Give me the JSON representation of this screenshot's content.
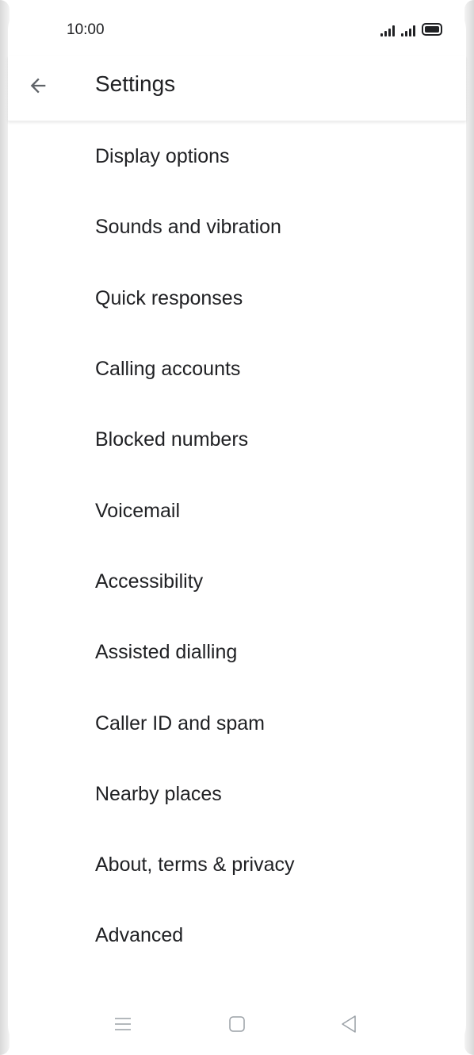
{
  "status_bar": {
    "time": "10:00"
  },
  "header": {
    "back_label": "Back",
    "title": "Settings"
  },
  "menu": {
    "items": [
      {
        "label": "Display options"
      },
      {
        "label": "Sounds and vibration"
      },
      {
        "label": "Quick responses"
      },
      {
        "label": "Calling accounts"
      },
      {
        "label": "Blocked numbers"
      },
      {
        "label": "Voicemail"
      },
      {
        "label": "Accessibility"
      },
      {
        "label": "Assisted dialling"
      },
      {
        "label": "Caller ID and spam"
      },
      {
        "label": "Nearby places"
      },
      {
        "label": "About, terms & privacy"
      },
      {
        "label": "Advanced"
      }
    ]
  },
  "nav_bar": {
    "icons": [
      "menu-icon",
      "home-icon",
      "back-triangle-icon"
    ]
  },
  "colors": {
    "text": "#202124",
    "icon": "#5f6368",
    "nav_icon": "#9aa0a6",
    "background": "#ffffff"
  }
}
